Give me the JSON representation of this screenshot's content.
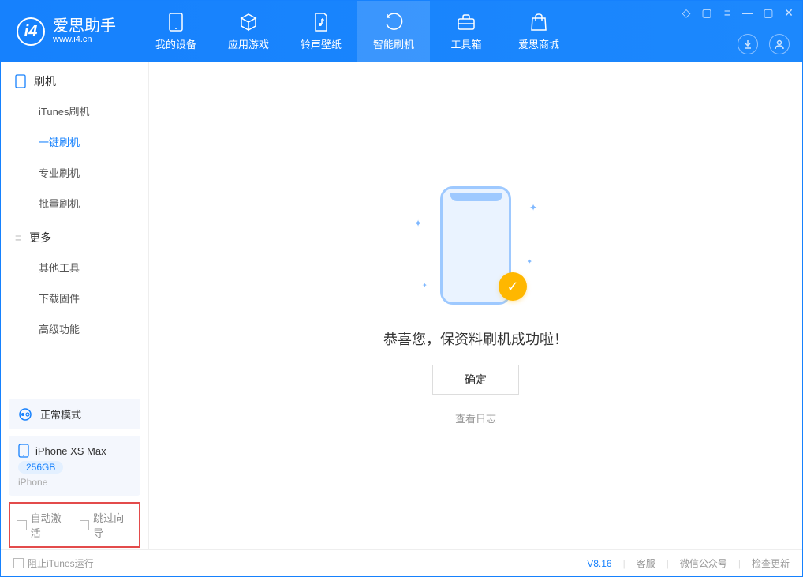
{
  "app": {
    "name_cn": "爱思助手",
    "name_en": "www.i4.cn",
    "logo_letter": "i4"
  },
  "nav": {
    "my_device": "我的设备",
    "apps_games": "应用游戏",
    "ring_wall": "铃声壁纸",
    "smart_flash": "智能刷机",
    "toolbox": "工具箱",
    "store": "爱思商城"
  },
  "sidebar": {
    "group_flash": "刷机",
    "itunes_flash": "iTunes刷机",
    "one_key_flash": "一键刷机",
    "pro_flash": "专业刷机",
    "batch_flash": "批量刷机",
    "group_more": "更多",
    "other_tools": "其他工具",
    "download_fw": "下载固件",
    "advanced": "高级功能"
  },
  "mode": {
    "label": "正常模式"
  },
  "device": {
    "name": "iPhone XS Max",
    "capacity": "256GB",
    "type": "iPhone"
  },
  "checks": {
    "auto_activate": "自动激活",
    "skip_guide": "跳过向导"
  },
  "main": {
    "success": "恭喜您，保资料刷机成功啦！",
    "ok": "确定",
    "view_log": "查看日志"
  },
  "footer": {
    "block_itunes": "阻止iTunes运行",
    "version": "V8.16",
    "support": "客服",
    "wechat": "微信公众号",
    "check_update": "检查更新"
  }
}
